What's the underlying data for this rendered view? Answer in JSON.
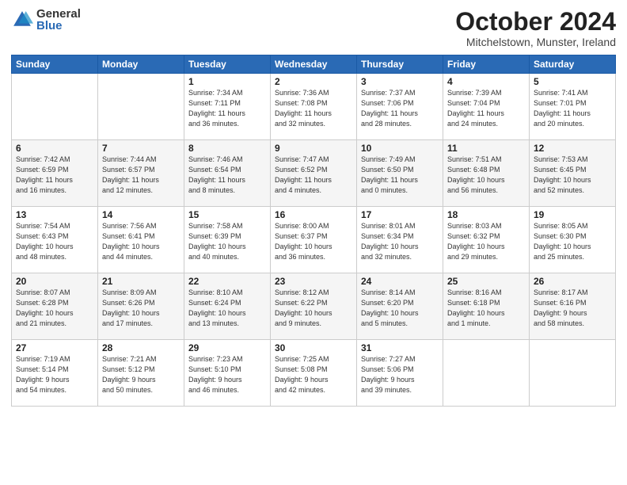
{
  "logo": {
    "general": "General",
    "blue": "Blue"
  },
  "title": "October 2024",
  "subtitle": "Mitchelstown, Munster, Ireland",
  "days_of_week": [
    "Sunday",
    "Monday",
    "Tuesday",
    "Wednesday",
    "Thursday",
    "Friday",
    "Saturday"
  ],
  "weeks": [
    [
      {
        "day": "",
        "info": ""
      },
      {
        "day": "",
        "info": ""
      },
      {
        "day": "1",
        "info": "Sunrise: 7:34 AM\nSunset: 7:11 PM\nDaylight: 11 hours\nand 36 minutes."
      },
      {
        "day": "2",
        "info": "Sunrise: 7:36 AM\nSunset: 7:08 PM\nDaylight: 11 hours\nand 32 minutes."
      },
      {
        "day": "3",
        "info": "Sunrise: 7:37 AM\nSunset: 7:06 PM\nDaylight: 11 hours\nand 28 minutes."
      },
      {
        "day": "4",
        "info": "Sunrise: 7:39 AM\nSunset: 7:04 PM\nDaylight: 11 hours\nand 24 minutes."
      },
      {
        "day": "5",
        "info": "Sunrise: 7:41 AM\nSunset: 7:01 PM\nDaylight: 11 hours\nand 20 minutes."
      }
    ],
    [
      {
        "day": "6",
        "info": "Sunrise: 7:42 AM\nSunset: 6:59 PM\nDaylight: 11 hours\nand 16 minutes."
      },
      {
        "day": "7",
        "info": "Sunrise: 7:44 AM\nSunset: 6:57 PM\nDaylight: 11 hours\nand 12 minutes."
      },
      {
        "day": "8",
        "info": "Sunrise: 7:46 AM\nSunset: 6:54 PM\nDaylight: 11 hours\nand 8 minutes."
      },
      {
        "day": "9",
        "info": "Sunrise: 7:47 AM\nSunset: 6:52 PM\nDaylight: 11 hours\nand 4 minutes."
      },
      {
        "day": "10",
        "info": "Sunrise: 7:49 AM\nSunset: 6:50 PM\nDaylight: 11 hours\nand 0 minutes."
      },
      {
        "day": "11",
        "info": "Sunrise: 7:51 AM\nSunset: 6:48 PM\nDaylight: 10 hours\nand 56 minutes."
      },
      {
        "day": "12",
        "info": "Sunrise: 7:53 AM\nSunset: 6:45 PM\nDaylight: 10 hours\nand 52 minutes."
      }
    ],
    [
      {
        "day": "13",
        "info": "Sunrise: 7:54 AM\nSunset: 6:43 PM\nDaylight: 10 hours\nand 48 minutes."
      },
      {
        "day": "14",
        "info": "Sunrise: 7:56 AM\nSunset: 6:41 PM\nDaylight: 10 hours\nand 44 minutes."
      },
      {
        "day": "15",
        "info": "Sunrise: 7:58 AM\nSunset: 6:39 PM\nDaylight: 10 hours\nand 40 minutes."
      },
      {
        "day": "16",
        "info": "Sunrise: 8:00 AM\nSunset: 6:37 PM\nDaylight: 10 hours\nand 36 minutes."
      },
      {
        "day": "17",
        "info": "Sunrise: 8:01 AM\nSunset: 6:34 PM\nDaylight: 10 hours\nand 32 minutes."
      },
      {
        "day": "18",
        "info": "Sunrise: 8:03 AM\nSunset: 6:32 PM\nDaylight: 10 hours\nand 29 minutes."
      },
      {
        "day": "19",
        "info": "Sunrise: 8:05 AM\nSunset: 6:30 PM\nDaylight: 10 hours\nand 25 minutes."
      }
    ],
    [
      {
        "day": "20",
        "info": "Sunrise: 8:07 AM\nSunset: 6:28 PM\nDaylight: 10 hours\nand 21 minutes."
      },
      {
        "day": "21",
        "info": "Sunrise: 8:09 AM\nSunset: 6:26 PM\nDaylight: 10 hours\nand 17 minutes."
      },
      {
        "day": "22",
        "info": "Sunrise: 8:10 AM\nSunset: 6:24 PM\nDaylight: 10 hours\nand 13 minutes."
      },
      {
        "day": "23",
        "info": "Sunrise: 8:12 AM\nSunset: 6:22 PM\nDaylight: 10 hours\nand 9 minutes."
      },
      {
        "day": "24",
        "info": "Sunrise: 8:14 AM\nSunset: 6:20 PM\nDaylight: 10 hours\nand 5 minutes."
      },
      {
        "day": "25",
        "info": "Sunrise: 8:16 AM\nSunset: 6:18 PM\nDaylight: 10 hours\nand 1 minute."
      },
      {
        "day": "26",
        "info": "Sunrise: 8:17 AM\nSunset: 6:16 PM\nDaylight: 9 hours\nand 58 minutes."
      }
    ],
    [
      {
        "day": "27",
        "info": "Sunrise: 7:19 AM\nSunset: 5:14 PM\nDaylight: 9 hours\nand 54 minutes."
      },
      {
        "day": "28",
        "info": "Sunrise: 7:21 AM\nSunset: 5:12 PM\nDaylight: 9 hours\nand 50 minutes."
      },
      {
        "day": "29",
        "info": "Sunrise: 7:23 AM\nSunset: 5:10 PM\nDaylight: 9 hours\nand 46 minutes."
      },
      {
        "day": "30",
        "info": "Sunrise: 7:25 AM\nSunset: 5:08 PM\nDaylight: 9 hours\nand 42 minutes."
      },
      {
        "day": "31",
        "info": "Sunrise: 7:27 AM\nSunset: 5:06 PM\nDaylight: 9 hours\nand 39 minutes."
      },
      {
        "day": "",
        "info": ""
      },
      {
        "day": "",
        "info": ""
      }
    ]
  ]
}
